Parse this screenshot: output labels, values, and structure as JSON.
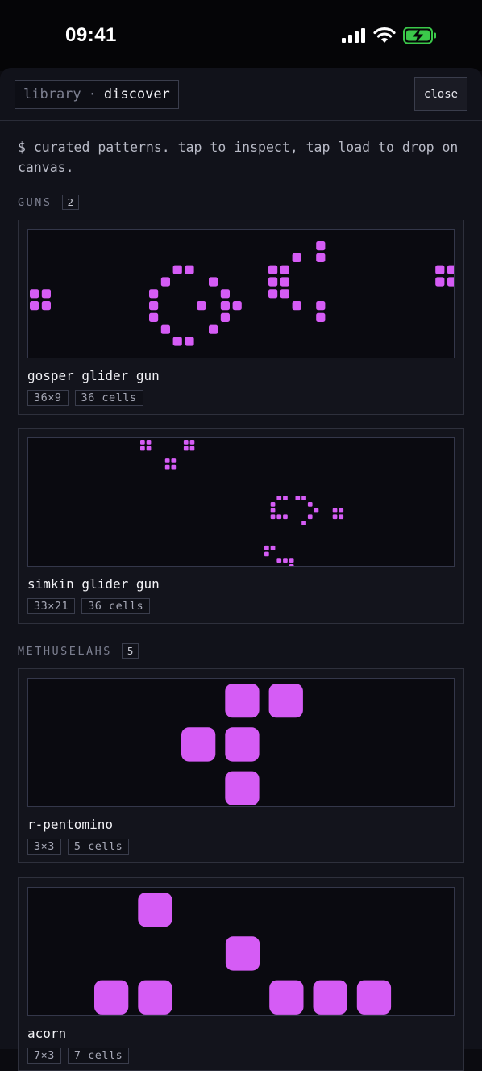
{
  "status_bar": {
    "time": "09:41"
  },
  "header": {
    "crumb_parent": "library",
    "crumb_separator": "·",
    "crumb_current": "discover",
    "close_label": "close"
  },
  "intro_text": "$ curated patterns. tap to inspect, tap load to drop on canvas.",
  "colors": {
    "cell": "#d55cf5",
    "background": "#11121a",
    "preview_bg": "#0a0a10"
  },
  "sections": [
    {
      "title": "GUNS",
      "count": "2"
    },
    {
      "title": "METHUSELAHS",
      "count": "5"
    }
  ],
  "patterns": [
    {
      "name": "gosper glider gun",
      "size_label": "36×9",
      "cells_label": "36 cells",
      "cols": 36,
      "rows": 9,
      "cells": [
        [
          0,
          4
        ],
        [
          0,
          5
        ],
        [
          1,
          4
        ],
        [
          1,
          5
        ],
        [
          10,
          4
        ],
        [
          10,
          5
        ],
        [
          10,
          6
        ],
        [
          11,
          3
        ],
        [
          11,
          7
        ],
        [
          12,
          2
        ],
        [
          12,
          8
        ],
        [
          13,
          2
        ],
        [
          13,
          8
        ],
        [
          14,
          5
        ],
        [
          15,
          3
        ],
        [
          15,
          7
        ],
        [
          16,
          4
        ],
        [
          16,
          5
        ],
        [
          16,
          6
        ],
        [
          17,
          5
        ],
        [
          20,
          2
        ],
        [
          20,
          3
        ],
        [
          20,
          4
        ],
        [
          21,
          2
        ],
        [
          21,
          3
        ],
        [
          21,
          4
        ],
        [
          22,
          1
        ],
        [
          22,
          5
        ],
        [
          24,
          0
        ],
        [
          24,
          1
        ],
        [
          24,
          5
        ],
        [
          24,
          6
        ],
        [
          34,
          2
        ],
        [
          34,
          3
        ],
        [
          35,
          2
        ],
        [
          35,
          3
        ]
      ]
    },
    {
      "name": "simkin glider gun",
      "size_label": "33×21",
      "cells_label": "36 cells",
      "cols": 33,
      "rows": 21,
      "cells": [
        [
          0,
          0
        ],
        [
          1,
          0
        ],
        [
          0,
          1
        ],
        [
          1,
          1
        ],
        [
          7,
          0
        ],
        [
          8,
          0
        ],
        [
          7,
          1
        ],
        [
          8,
          1
        ],
        [
          4,
          3
        ],
        [
          5,
          3
        ],
        [
          4,
          4
        ],
        [
          5,
          4
        ],
        [
          22,
          9
        ],
        [
          23,
          9
        ],
        [
          25,
          9
        ],
        [
          26,
          9
        ],
        [
          21,
          10
        ],
        [
          27,
          10
        ],
        [
          21,
          11
        ],
        [
          28,
          11
        ],
        [
          31,
          11
        ],
        [
          32,
          11
        ],
        [
          21,
          12
        ],
        [
          22,
          12
        ],
        [
          23,
          12
        ],
        [
          27,
          12
        ],
        [
          31,
          12
        ],
        [
          32,
          12
        ],
        [
          26,
          13
        ],
        [
          20,
          17
        ],
        [
          21,
          17
        ],
        [
          20,
          18
        ],
        [
          22,
          19
        ],
        [
          23,
          19
        ],
        [
          24,
          19
        ],
        [
          24,
          20
        ]
      ]
    },
    {
      "name": "r-pentomino",
      "size_label": "3×3",
      "cells_label": "5 cells",
      "cols": 3,
      "rows": 3,
      "cells": [
        [
          1,
          0
        ],
        [
          2,
          0
        ],
        [
          0,
          1
        ],
        [
          1,
          1
        ],
        [
          1,
          2
        ]
      ]
    },
    {
      "name": "acorn",
      "size_label": "7×3",
      "cells_label": "7 cells",
      "cols": 7,
      "rows": 3,
      "cells": [
        [
          1,
          0
        ],
        [
          3,
          1
        ],
        [
          0,
          2
        ],
        [
          1,
          2
        ],
        [
          4,
          2
        ],
        [
          5,
          2
        ],
        [
          6,
          2
        ]
      ]
    }
  ]
}
